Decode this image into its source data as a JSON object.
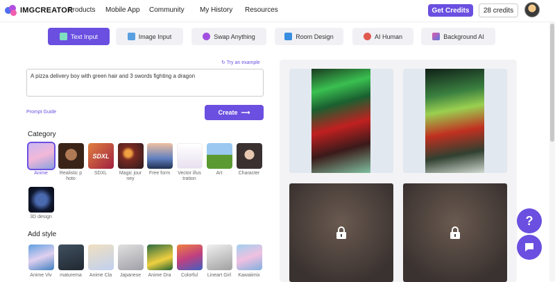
{
  "header": {
    "logo_text": "IMGCREATOR",
    "nav": [
      "Products",
      "Mobile App",
      "Community",
      "My History",
      "Resources"
    ],
    "get_credits": "Get Credits",
    "credits": "28 credits"
  },
  "tabs": [
    {
      "label": "Text Input",
      "icon": "text-input-icon",
      "active": true
    },
    {
      "label": "Image Input",
      "icon": "image-input-icon",
      "active": false
    },
    {
      "label": "Swap Anything",
      "icon": "swap-icon",
      "active": false
    },
    {
      "label": "Room Design",
      "icon": "room-design-icon",
      "active": false
    },
    {
      "label": "AI Human",
      "icon": "ai-human-icon",
      "active": false
    },
    {
      "label": "Background AI",
      "icon": "background-ai-icon",
      "active": false
    }
  ],
  "prompt": {
    "try_example": "Try an example",
    "text": "A pizza delivery boy with green hair and 3 swords fighting a dragon",
    "guide": "Prompt Guide",
    "create": "Create"
  },
  "category": {
    "title": "Category",
    "items": [
      {
        "label": "Anime",
        "selected": true
      },
      {
        "label": "Realistic p hoto",
        "selected": false
      },
      {
        "label": "SDXL",
        "selected": false,
        "thumb_text": "SDXL"
      },
      {
        "label": "Magic jour ney",
        "selected": false
      },
      {
        "label": "Free form",
        "selected": false
      },
      {
        "label": "Vector illus tration",
        "selected": false
      },
      {
        "label": "Art",
        "selected": false
      },
      {
        "label": "Character",
        "selected": false
      },
      {
        "label": "3D design",
        "selected": false
      }
    ]
  },
  "style": {
    "title": "Add style",
    "items": [
      "Anime Viv",
      "maturema",
      "Anime Cla",
      "Japanese",
      "Anime Dra",
      "Colorful",
      "Lineart Girl",
      "Kawaiimix"
    ]
  },
  "results": {
    "cards": [
      {
        "locked": false
      },
      {
        "locked": false
      },
      {
        "locked": true
      },
      {
        "locked": true
      }
    ]
  },
  "fab": {
    "help": "?",
    "chat_icon": "chat-icon"
  },
  "colors": {
    "accent": "#6a4fe0"
  }
}
